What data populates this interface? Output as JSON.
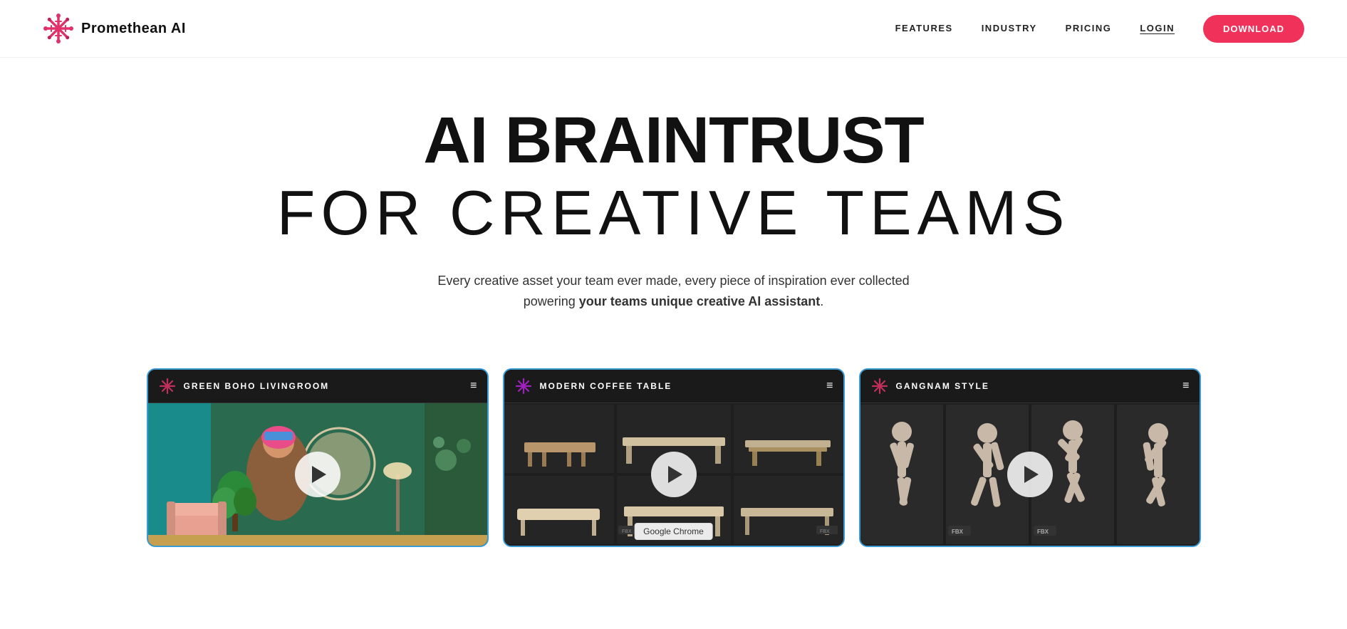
{
  "nav": {
    "logo_text": "Promethean AI",
    "links": [
      {
        "id": "features",
        "label": "FEATURES"
      },
      {
        "id": "industry",
        "label": "INDUSTRY"
      },
      {
        "id": "pricing",
        "label": "PRICING"
      },
      {
        "id": "login",
        "label": "LOGIN",
        "style": "login"
      }
    ],
    "download_btn": "DOWNLOAD"
  },
  "hero": {
    "title_bold": "AI BRAINTRUST",
    "title_light": "FOR CREATIVE TEAMS",
    "subtitle_part1": "Every creative asset your team ever made, every piece of inspiration ever collected",
    "subtitle_part2": "powering ",
    "subtitle_bold": "your teams unique creative AI assistant",
    "subtitle_end": "."
  },
  "cards": [
    {
      "id": "card-1",
      "title": "GREEN BOHO LIVINGROOM",
      "type": "livingroom",
      "border_color": "#3a9bd5"
    },
    {
      "id": "card-2",
      "title": "MODERN COFFEE TABLE",
      "type": "furniture-grid",
      "border_color": "#3a9bd5",
      "has_tooltip": true,
      "tooltip": "Google Chrome"
    },
    {
      "id": "card-3",
      "title": "GANGNAM STYLE",
      "type": "dance-grid",
      "border_color": "#3a9bd5"
    }
  ],
  "colors": {
    "accent_pink": "#f0315a",
    "border_blue": "#3a9bd5",
    "bg_dark": "#1a1a1a",
    "text_dark": "#111111"
  }
}
